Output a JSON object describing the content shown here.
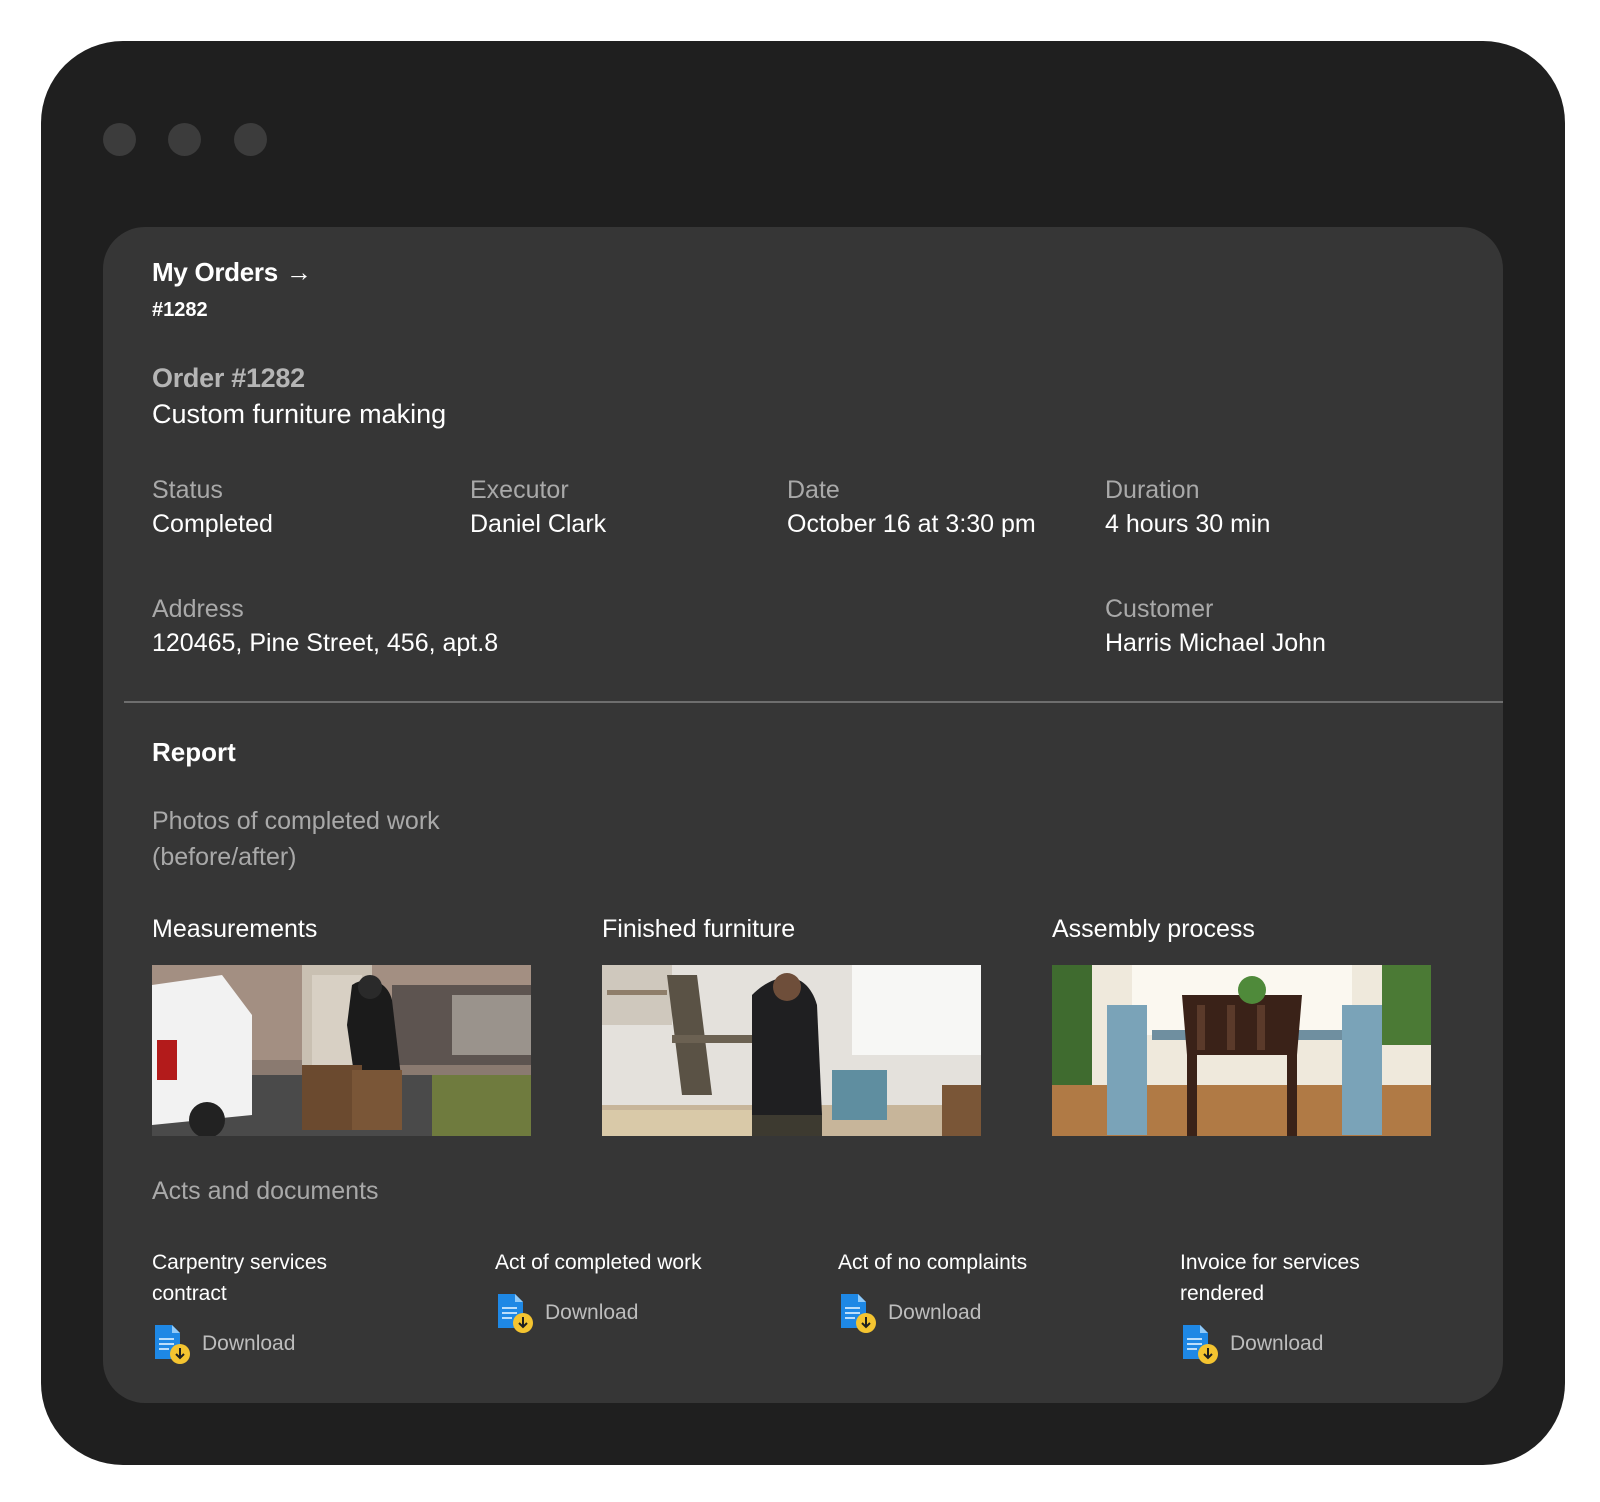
{
  "window": {
    "controls": [
      "close",
      "minimize",
      "maximize"
    ]
  },
  "breadcrumb": {
    "label": "My Orders",
    "arrow": "→",
    "order_ref": "#1282"
  },
  "order": {
    "number": "Order #1282",
    "title": "Custom furniture making",
    "status": {
      "label": "Status",
      "value": "Completed"
    },
    "executor": {
      "label": "Executor",
      "value": "Daniel Clark"
    },
    "date": {
      "label": "Date",
      "value": "October 16 at 3:30 pm"
    },
    "duration": {
      "label": "Duration",
      "value": "4 hours 30 min"
    },
    "address": {
      "label": "Address",
      "value": "120465, Pine Street, 456, apt.8"
    },
    "customer": {
      "label": "Customer",
      "value": "Harris Michael John"
    }
  },
  "report": {
    "title": "Report",
    "photos_label": "Photos of completed work (before/after)",
    "photos": [
      {
        "caption": "Measurements",
        "image": "man-with-chairs-by-van"
      },
      {
        "caption": "Finished furniture",
        "image": "man-sanding-chair-in-workshop"
      },
      {
        "caption": "Assembly process",
        "image": "dining-table-with-blue-chairs"
      }
    ],
    "acts_label": "Acts and documents",
    "documents": [
      {
        "name": "Carpentry services contract",
        "action": "Download"
      },
      {
        "name": "Act of completed work",
        "action": "Download"
      },
      {
        "name": "Act of no complaints",
        "action": "Download"
      },
      {
        "name": "Invoice for services rendered",
        "action": "Download"
      }
    ]
  },
  "colors": {
    "frame": "#1f1f1f",
    "panel": "#363636",
    "label_gray": "#a9a9a9",
    "doc_icon_blue": "#1e88e5",
    "doc_icon_badge": "#f4c430"
  }
}
